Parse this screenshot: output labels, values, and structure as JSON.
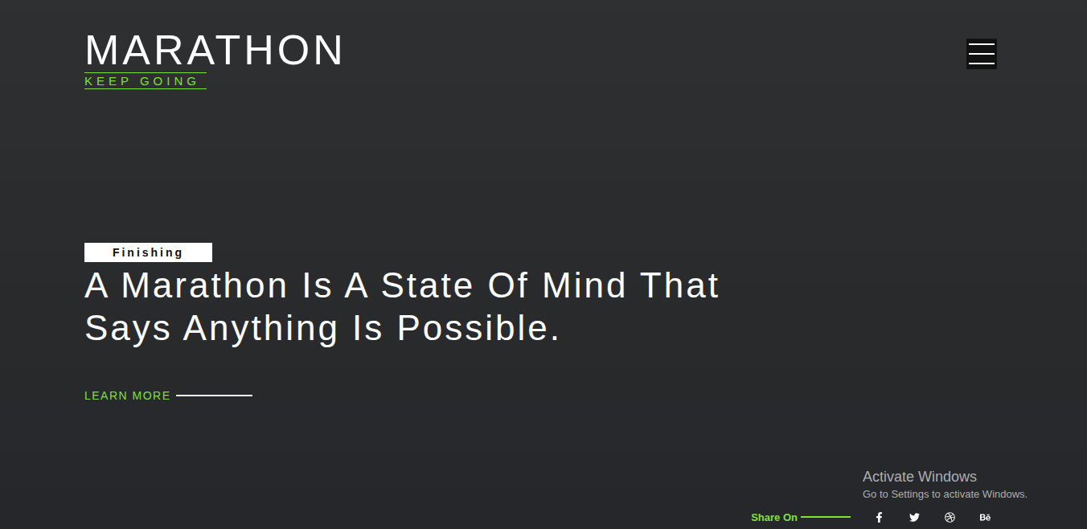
{
  "brand": {
    "title": "MARATHON",
    "tagline": "KEEP GOING"
  },
  "hero": {
    "badge": "Finishing",
    "heading": "A Marathon Is A State Of Mind That Says Anything Is Possible.",
    "link": "LEARN MORE"
  },
  "share": {
    "label": "Share On"
  },
  "watermark": {
    "title": "Activate Windows",
    "subtitle": "Go to Settings to activate Windows."
  }
}
